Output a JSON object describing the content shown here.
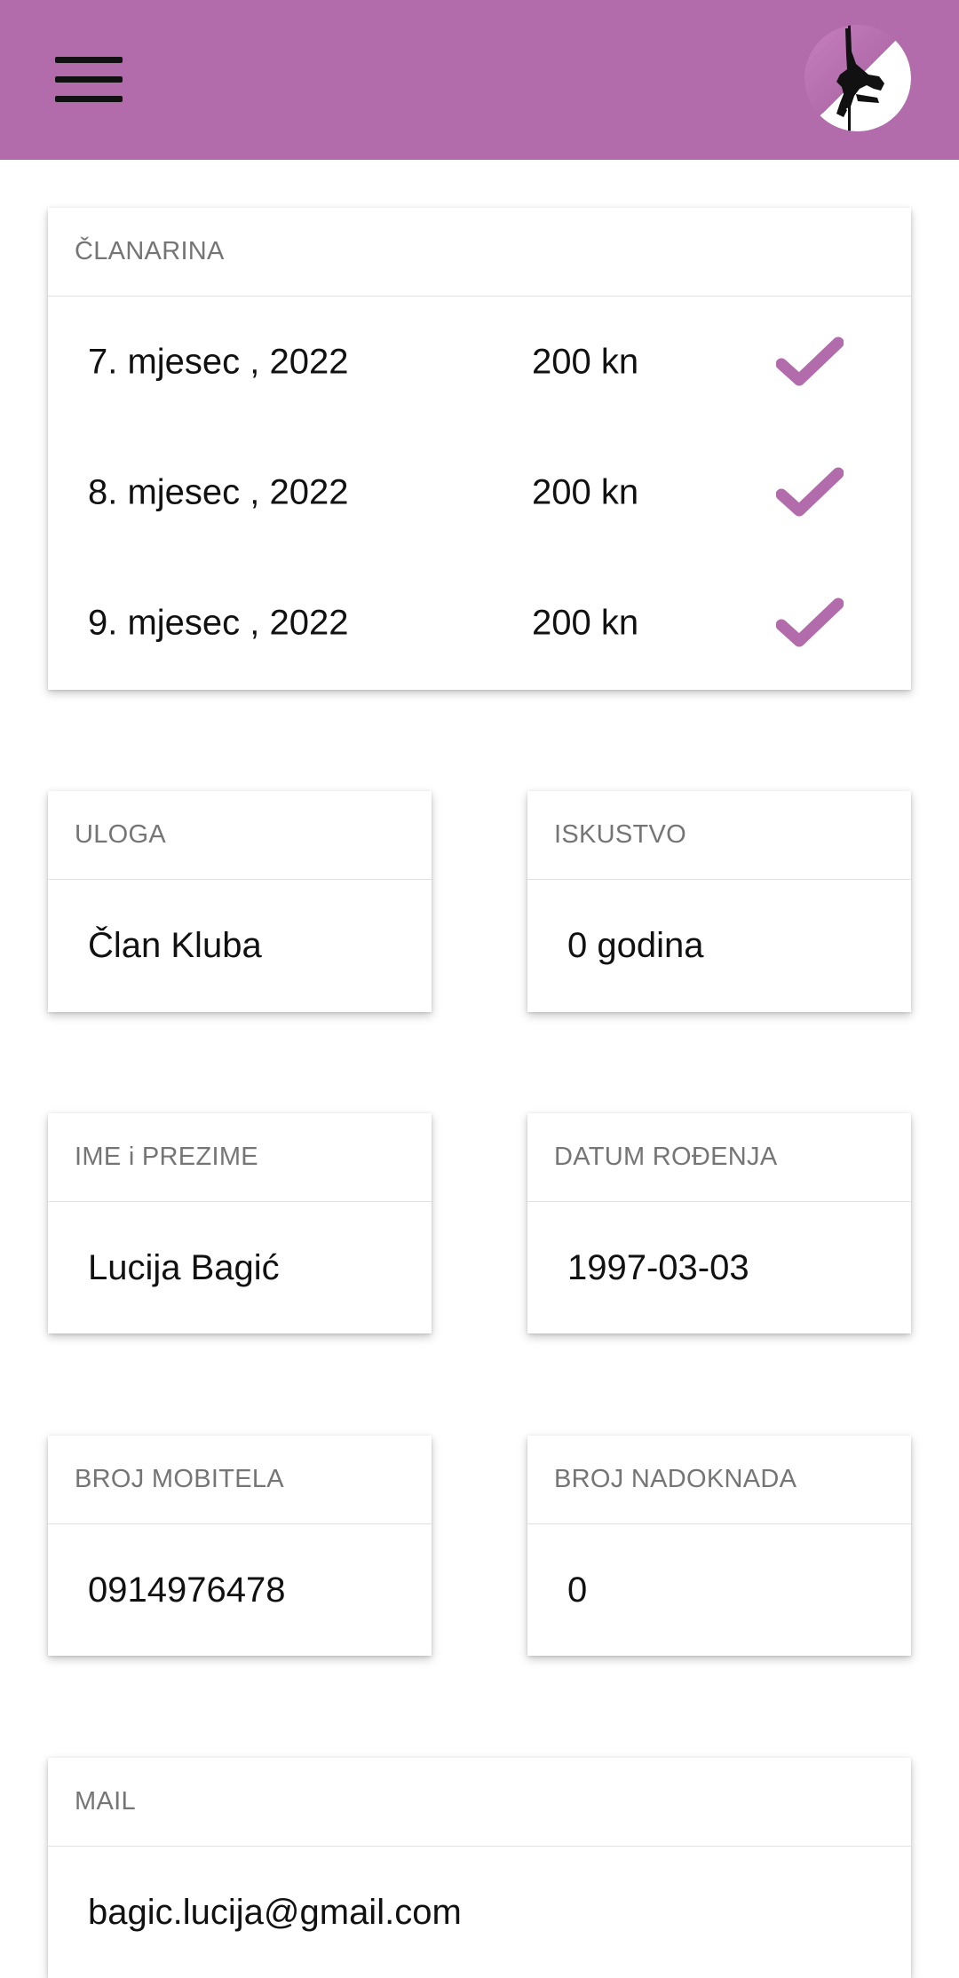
{
  "header": {
    "menu_icon": "hamburger-menu-icon",
    "avatar_icon": "pole-dancer-logo",
    "bg_color": "#b36cab"
  },
  "membership": {
    "title": "ČLANARINA",
    "rows": [
      {
        "month": "7. mjesec , 2022",
        "amount": "200 kn",
        "status_icon": "checkmark-icon"
      },
      {
        "month": "8. mjesec , 2022",
        "amount": "200 kn",
        "status_icon": "checkmark-icon"
      },
      {
        "month": "9. mjesec , 2022",
        "amount": "200 kn",
        "status_icon": "checkmark-icon"
      }
    ],
    "check_color": "#b36cab"
  },
  "role": {
    "label": "ULOGA",
    "value": "Član Kluba"
  },
  "experience": {
    "label": "ISKUSTVO",
    "value": "0 godina"
  },
  "name": {
    "label": "IME i PREZIME",
    "value": "Lucija Bagić"
  },
  "birthdate": {
    "label": "DATUM ROĐENJA",
    "value": "1997-03-03"
  },
  "phone": {
    "label": "BROJ MOBITELA",
    "value": "0914976478"
  },
  "compensations": {
    "label": "BROJ NADOKNADA",
    "value": "0"
  },
  "mail": {
    "label": "MAIL",
    "value": "bagic.lucija@gmail.com"
  }
}
